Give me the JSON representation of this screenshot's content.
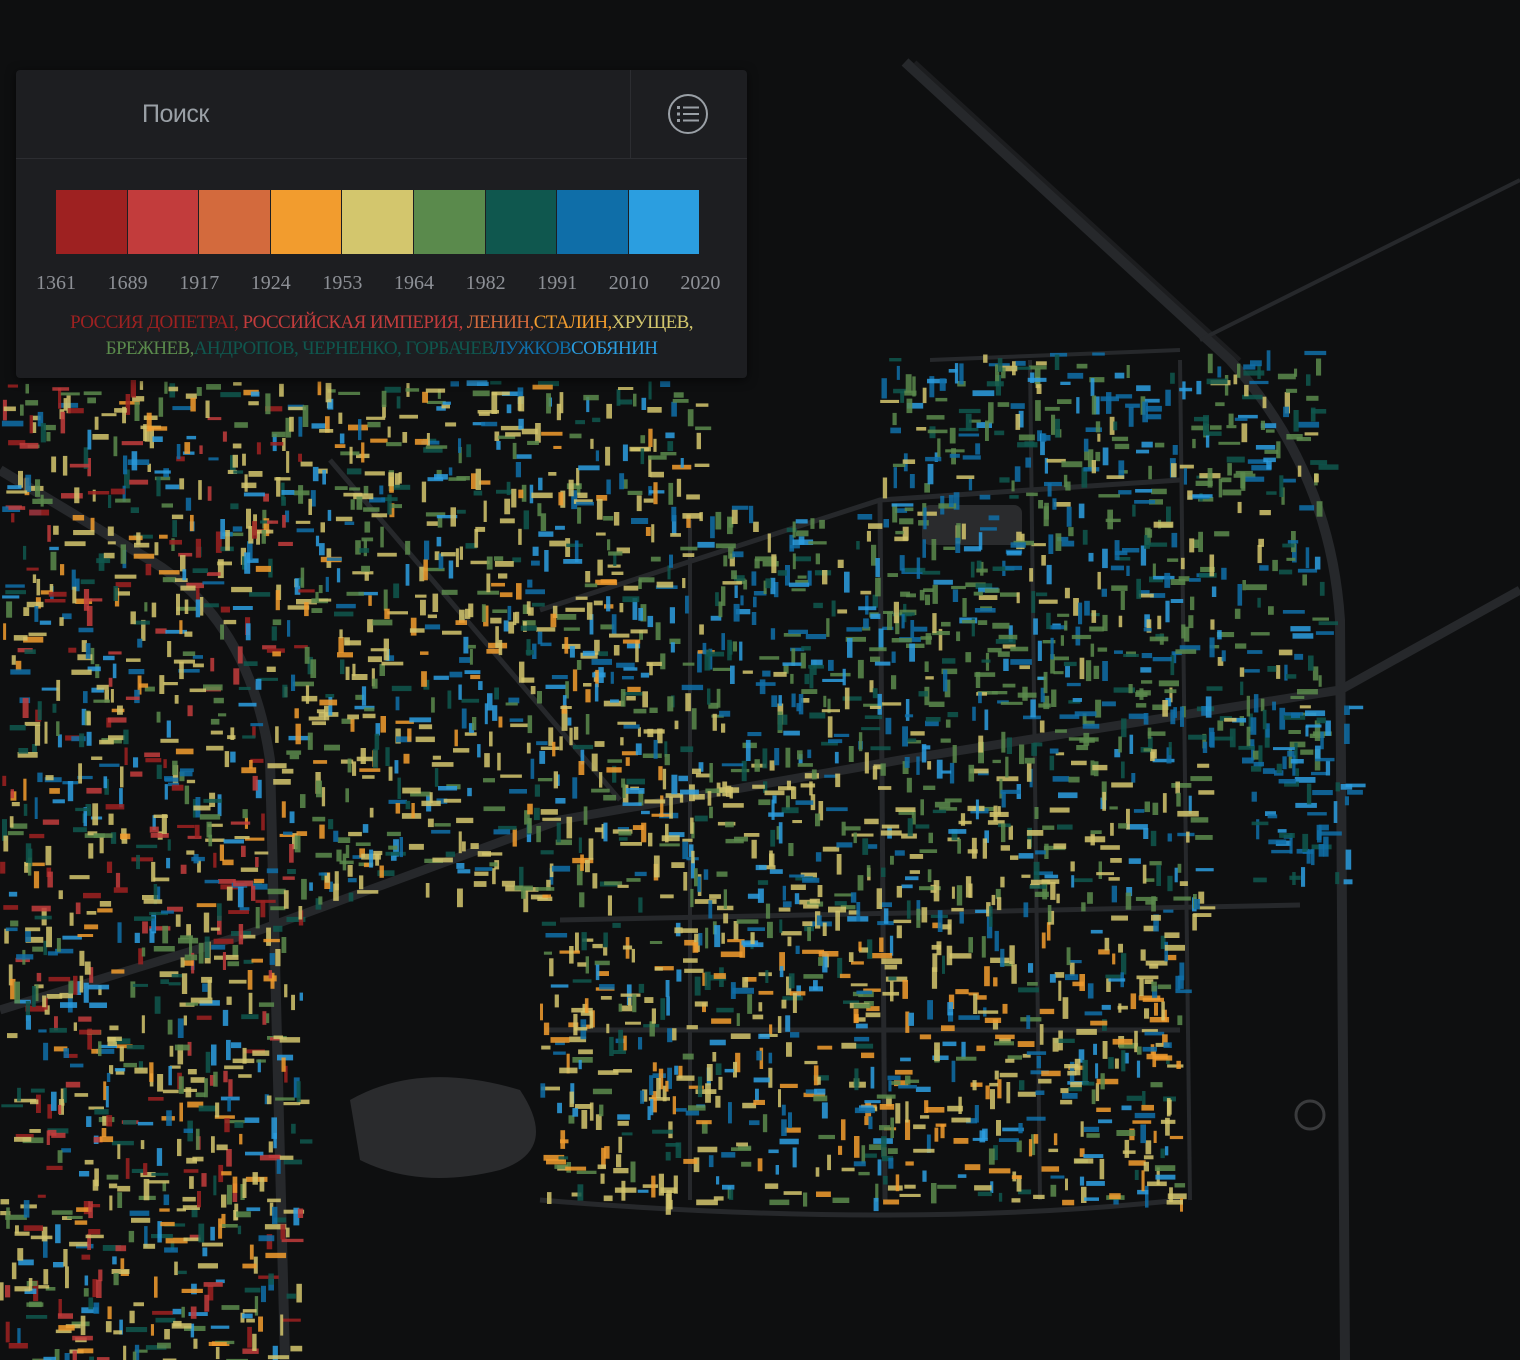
{
  "search": {
    "placeholder": "Поиск",
    "value": ""
  },
  "menu": {
    "icon": "list-icon"
  },
  "legend": {
    "swatch_colors": [
      "#9e2121",
      "#c23c3c",
      "#d36a3d",
      "#f29c2e",
      "#d3c66d",
      "#5a8a4c",
      "#0f574e",
      "#0f6ea8",
      "#2b9ee0"
    ],
    "ticks": [
      "1361",
      "1689",
      "1917",
      "1924",
      "1953",
      "1964",
      "1982",
      "1991",
      "2010",
      "2020"
    ]
  },
  "eras": [
    {
      "label": "РОССИЯ ДОПЕТРА",
      "color": "#9e2121"
    },
    {
      "label": "I, ",
      "color": "#9e2121"
    },
    {
      "label": "РОССИЙСКАЯ ИМПЕРИЯ,",
      "color": "#c23c3c"
    },
    {
      "label": " ЛЕНИН,",
      "color": "#d36a3d"
    },
    {
      "label": "СТАЛИН,",
      "color": "#f29c2e"
    },
    {
      "label": "ХРУЩЕВ,",
      "color": "#d3c66d"
    },
    {
      "label": "БРЕЖНЕВ,",
      "color": "#5a8a4c"
    },
    {
      "label": "АНДРОПОВ, ЧЕРНЕНКО, ГОРБАЧЕВ",
      "color": "#0f574e"
    },
    {
      "label": "ЛУЖКОВ",
      "color": "#0f6ea8"
    },
    {
      "label": "СОБЯНИН",
      "color": "#2b9ee0"
    }
  ]
}
